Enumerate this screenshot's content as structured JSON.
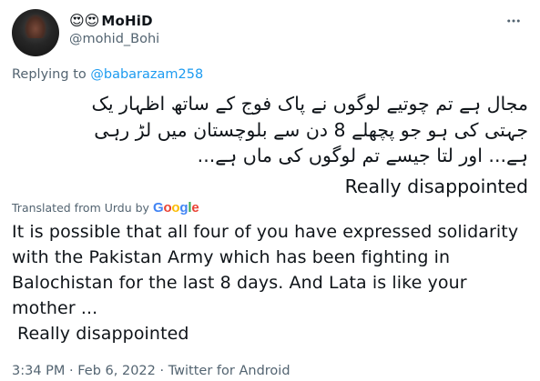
{
  "tweet": {
    "author": {
      "emojis": "😍😍",
      "display_name": "MoHiD",
      "handle": "@mohid_Bohi"
    },
    "reply": {
      "prefix": "Replying to",
      "mention": "@babarazam258"
    },
    "original_lines": [
      "مجال ہے تم چوتیے لوگوں نے پاک فوج کے ساتھ اظہار یک",
      "جہتی کی ہو جو پچھلے 8 دن سے بلوچستان میں لڑ رہی",
      "ہے... اور لتا جیسے تم لوگوں کی ماں ہے..."
    ],
    "original_english": "Really disappointed",
    "translated_label": "Translated from Urdu by",
    "translator_brand": "Google",
    "translation": "It is possible that all four of you have expressed solidarity with the Pakistan Army which has been fighting in Balochistan for the last 8 days. And Lata is like your mother ...",
    "translation_tail": "Really disappointed",
    "meta": "3:34 PM · Feb 6, 2022 · Twitter for Android"
  },
  "colors": {
    "text": "#0f1419",
    "secondary": "#536471",
    "link": "#1d9bf0"
  },
  "icons": [
    "more-icon",
    "google-logo"
  ]
}
